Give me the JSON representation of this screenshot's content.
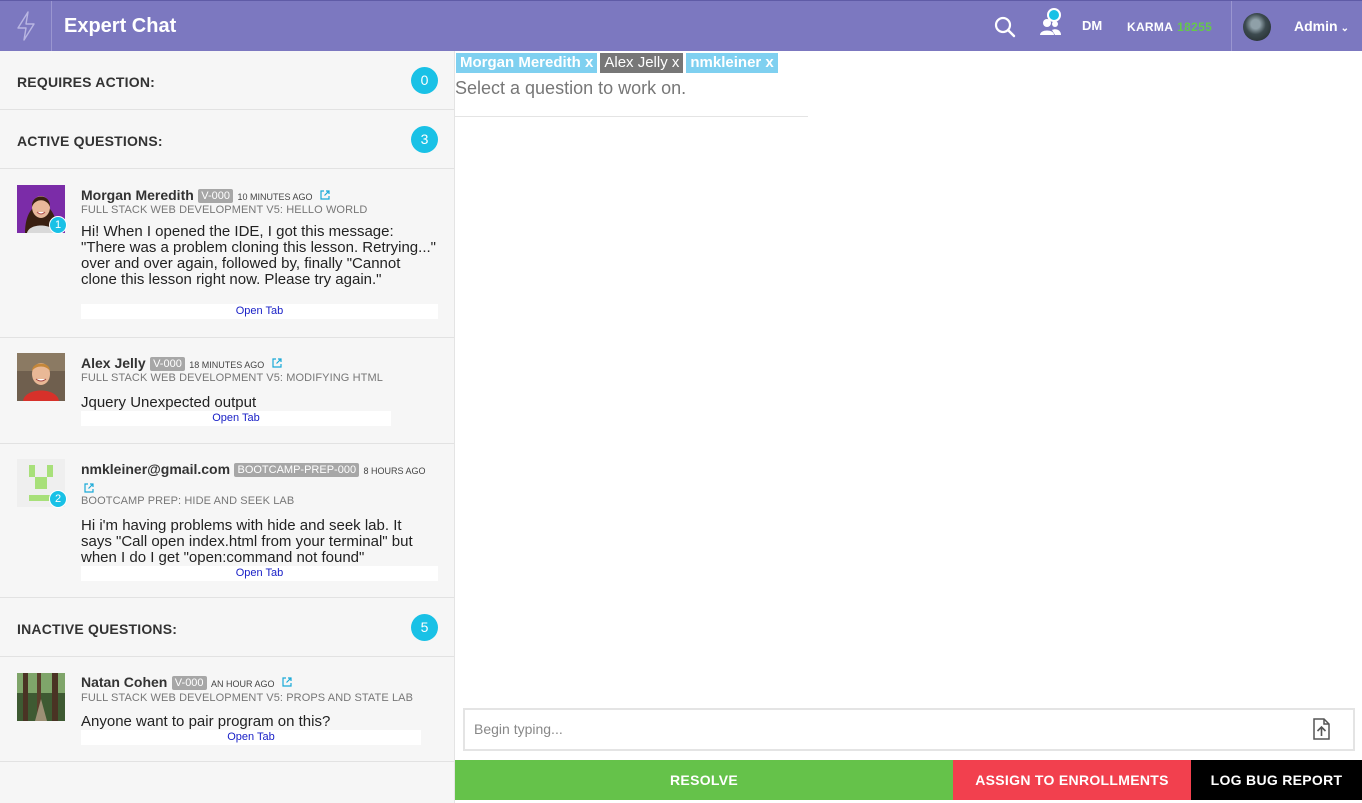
{
  "header": {
    "title": "Expert Chat",
    "dm_label": "DM",
    "karma_label": "KARMA",
    "karma_value": "18255",
    "user_label": "Admin",
    "accent": "#7c78c0"
  },
  "sidebar": {
    "requires_action": {
      "label": "REQUIRES ACTION:",
      "count": "0"
    },
    "active": {
      "label": "ACTIVE QUESTIONS:",
      "count": "3",
      "items": [
        {
          "name": "Morgan Meredith",
          "tag": "V-000",
          "time": "10 MINUTES AGO",
          "course": "FULL STACK WEB DEVELOPMENT V5: HELLO WORLD",
          "text": "Hi! When I opened the IDE, I got this message: \"There was a problem cloning this lesson. Retrying...\" over and over again, followed by, finally \"Cannot clone this lesson right now. Please try again.\"",
          "unread": "1",
          "open_tab": "Open Tab"
        },
        {
          "name": "Alex Jelly",
          "tag": "V-000",
          "time": "18 MINUTES AGO",
          "course": "FULL STACK WEB DEVELOPMENT V5: MODIFYING HTML",
          "text": "Jquery Unexpected output",
          "open_tab": "Open Tab"
        },
        {
          "name": "nmkleiner@gmail.com",
          "tag": "BOOTCAMP-PREP-000",
          "time": "8 HOURS AGO",
          "course": "BOOTCAMP PREP: HIDE AND SEEK LAB",
          "text": "Hi i'm having problems with hide and seek lab. It says \"Call open index.html from your terminal\" but when I do I get \"open:command not found\"",
          "unread": "2",
          "open_tab": "Open Tab"
        }
      ]
    },
    "inactive": {
      "label": "INACTIVE QUESTIONS:",
      "count": "5",
      "items": [
        {
          "name": "Natan Cohen",
          "tag": "V-000",
          "time": "AN HOUR AGO",
          "course": "FULL STACK WEB DEVELOPMENT V5: PROPS AND STATE LAB",
          "text": "Anyone want to pair program on this?",
          "open_tab": "Open Tab"
        }
      ]
    }
  },
  "main": {
    "pills": [
      "Morgan Meredith x",
      "Alex Jelly x",
      "nmkleiner x"
    ],
    "prompt": "Select a question to work on.",
    "composer_placeholder": "Begin typing..."
  },
  "actions": {
    "resolve": "RESOLVE",
    "assign": "ASSIGN TO ENROLLMENTS",
    "bug": "LOG BUG REPORT",
    "colors": {
      "resolve": "#65c24a",
      "assign": "#f2404e",
      "bug": "#000000"
    }
  },
  "icons": [
    "bolt-icon",
    "search-icon",
    "users-icon",
    "chevron-down-icon",
    "external-link-icon",
    "upload-icon"
  ]
}
